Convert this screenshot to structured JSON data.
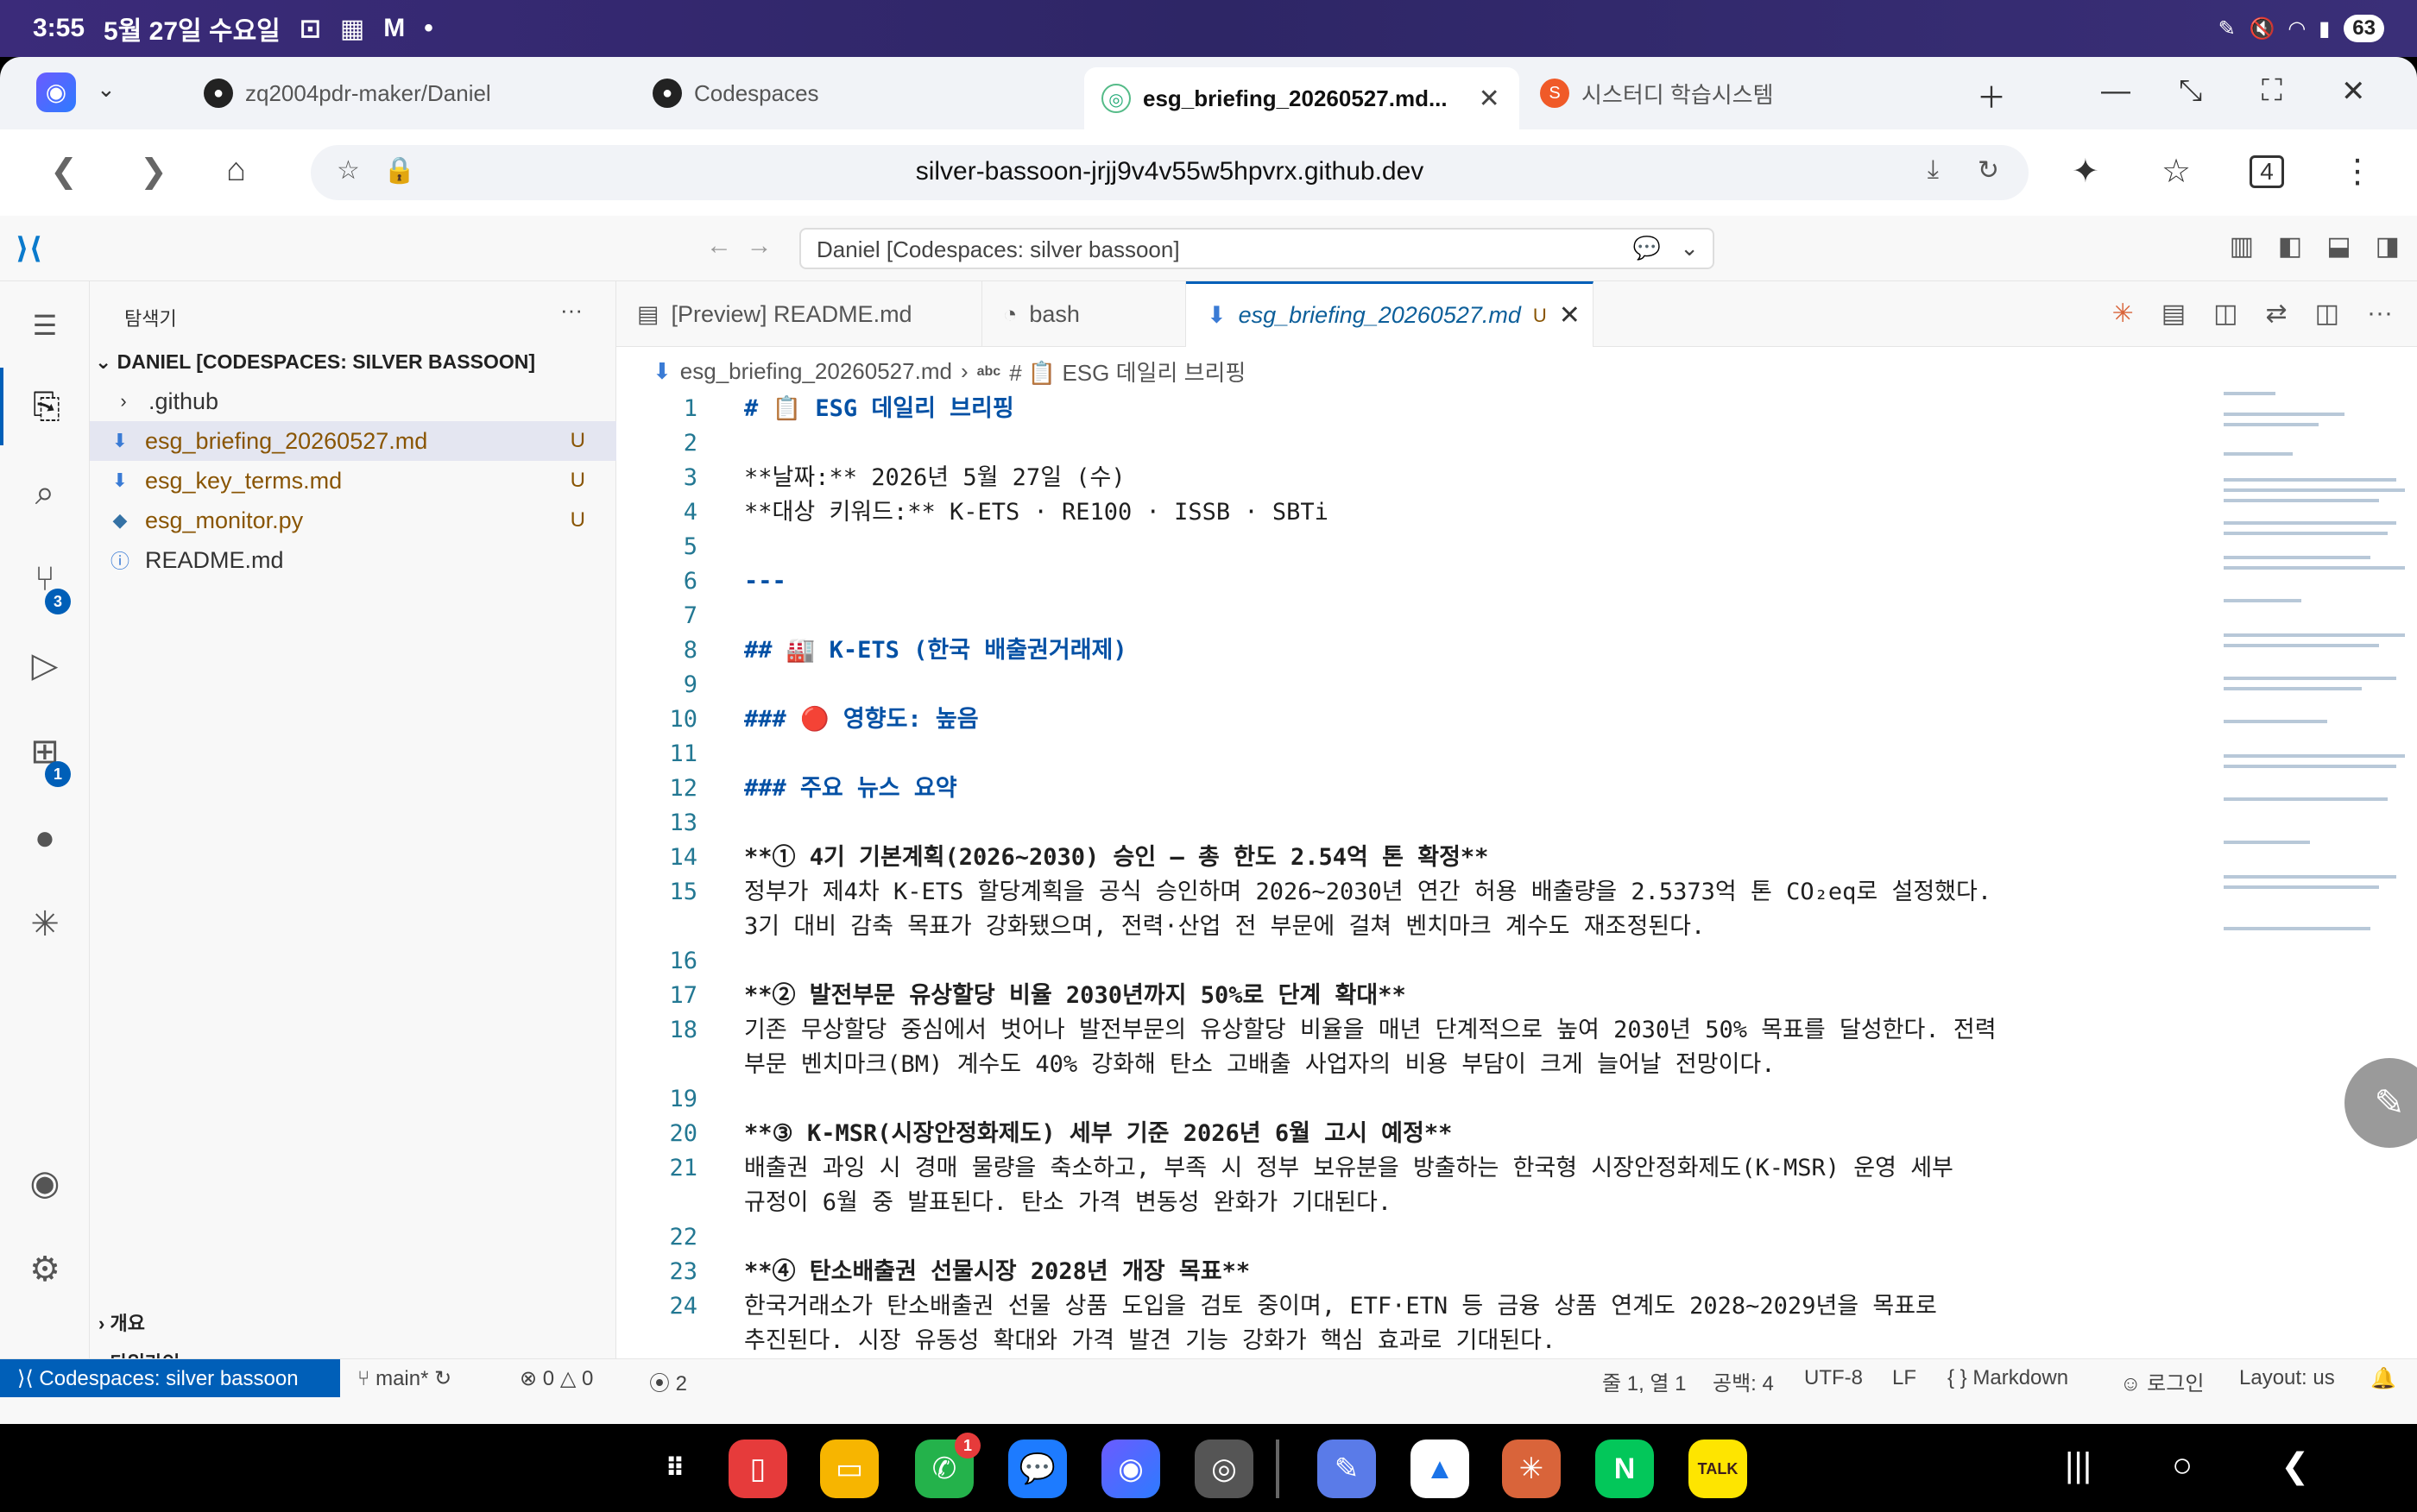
{
  "status": {
    "time": "3:55",
    "date": "5월 27일 수요일",
    "battery": "63"
  },
  "browser": {
    "tabs": [
      {
        "label": "zq2004pdr-maker/Daniel"
      },
      {
        "label": "Codespaces"
      },
      {
        "label": "esg_briefing_20260527.md..."
      },
      {
        "label": "시스터디 학습시스템"
      }
    ],
    "url": "silver-bassoon-jrjj9v4v55w5hpvrx.github.dev",
    "tab_count": "4"
  },
  "vscode": {
    "command_center": "Daniel [Codespaces: silver bassoon]",
    "explorer_title": "탐색기",
    "folder": "DANIEL [CODESPACES: SILVER BASSOON]",
    "tree": [
      {
        "label": ".github",
        "status": ""
      },
      {
        "label": "esg_briefing_20260527.md",
        "status": "U"
      },
      {
        "label": "esg_key_terms.md",
        "status": "U"
      },
      {
        "label": "esg_monitor.py",
        "status": "U"
      },
      {
        "label": "README.md",
        "status": ""
      }
    ],
    "outline": "개요",
    "timeline": "타임라인",
    "badges": {
      "scm": "3",
      "extensions": "1"
    },
    "editor_tabs": [
      {
        "label": "[Preview] README.md"
      },
      {
        "label": "bash"
      },
      {
        "label": "esg_briefing_20260527.md",
        "status": "U"
      }
    ],
    "breadcrumb": {
      "file": "esg_briefing_20260527.md",
      "symbol": "# 📋 ESG 데일리 브리핑"
    },
    "lines": [
      {
        "n": "1",
        "t": "# 📋 ESG 데일리 브리핑"
      },
      {
        "n": "2",
        "t": ""
      },
      {
        "n": "3",
        "t": "**날짜:** 2026년 5월 27일 (수)"
      },
      {
        "n": "4",
        "t": "**대상 키워드:** K-ETS · RE100 · ISSB · SBTi"
      },
      {
        "n": "5",
        "t": ""
      },
      {
        "n": "6",
        "t": "---"
      },
      {
        "n": "7",
        "t": ""
      },
      {
        "n": "8",
        "t": "## 🏭 K-ETS (한국 배출권거래제)"
      },
      {
        "n": "9",
        "t": ""
      },
      {
        "n": "10",
        "t": "### 🔴 영향도: 높음"
      },
      {
        "n": "11",
        "t": ""
      },
      {
        "n": "12",
        "t": "### 주요 뉴스 요약"
      },
      {
        "n": "13",
        "t": ""
      },
      {
        "n": "14",
        "t": "**① 4기 기본계획(2026~2030) 승인 — 총 한도 2.54억 톤 확정**"
      },
      {
        "n": "15",
        "t": "정부가 제4차 K-ETS 할당계획을 공식 승인하며 2026~2030년 연간 허용 배출량을 2.5373억 톤 CO₂eq로 설정했다."
      },
      {
        "n": "",
        "t": "3기 대비 감축 목표가 강화됐으며, 전력·산업 전 부문에 걸쳐 벤치마크 계수도 재조정된다."
      },
      {
        "n": "16",
        "t": ""
      },
      {
        "n": "17",
        "t": "**② 발전부문 유상할당 비율 2030년까지 50%로 단계 확대**"
      },
      {
        "n": "18",
        "t": "기존 무상할당 중심에서 벗어나 발전부문의 유상할당 비율을 매년 단계적으로 높여 2030년 50% 목표를 달성한다. 전력"
      },
      {
        "n": "",
        "t": "부문 벤치마크(BM) 계수도 40% 강화해 탄소 고배출 사업자의 비용 부담이 크게 늘어날 전망이다."
      },
      {
        "n": "19",
        "t": ""
      },
      {
        "n": "20",
        "t": "**③ K-MSR(시장안정화제도) 세부 기준 2026년 6월 고시 예정**"
      },
      {
        "n": "21",
        "t": "배출권 과잉 시 경매 물량을 축소하고, 부족 시 정부 보유분을 방출하는 한국형 시장안정화제도(K-MSR) 운영 세부"
      },
      {
        "n": "",
        "t": "규정이 6월 중 발표된다. 탄소 가격 변동성 완화가 기대된다."
      },
      {
        "n": "22",
        "t": ""
      },
      {
        "n": "23",
        "t": "**④ 탄소배출권 선물시장 2028년 개장 목표**"
      },
      {
        "n": "24",
        "t": "한국거래소가 탄소배출권 선물 상품 도입을 검토 중이며, ETF·ETN 등 금융 상품 연계도 2028~2029년을 목표로"
      },
      {
        "n": "",
        "t": "추진된다. 시장 유동성 확대와 가격 발견 기능 강화가 핵심 효과로 기대된다."
      },
      {
        "n": "25",
        "t": ""
      }
    ],
    "statusbar": {
      "remote": "Codespaces: silver bassoon",
      "branch": "main*",
      "errors": "0",
      "warnings": "0",
      "ports": "2",
      "position": "줄 1, 열 1",
      "spaces": "공백: 4",
      "encoding": "UTF-8",
      "eol": "LF",
      "language": "Markdown",
      "login": "로그인",
      "layout": "Layout: us"
    }
  },
  "taskbar": {
    "phone_badge": "1"
  }
}
